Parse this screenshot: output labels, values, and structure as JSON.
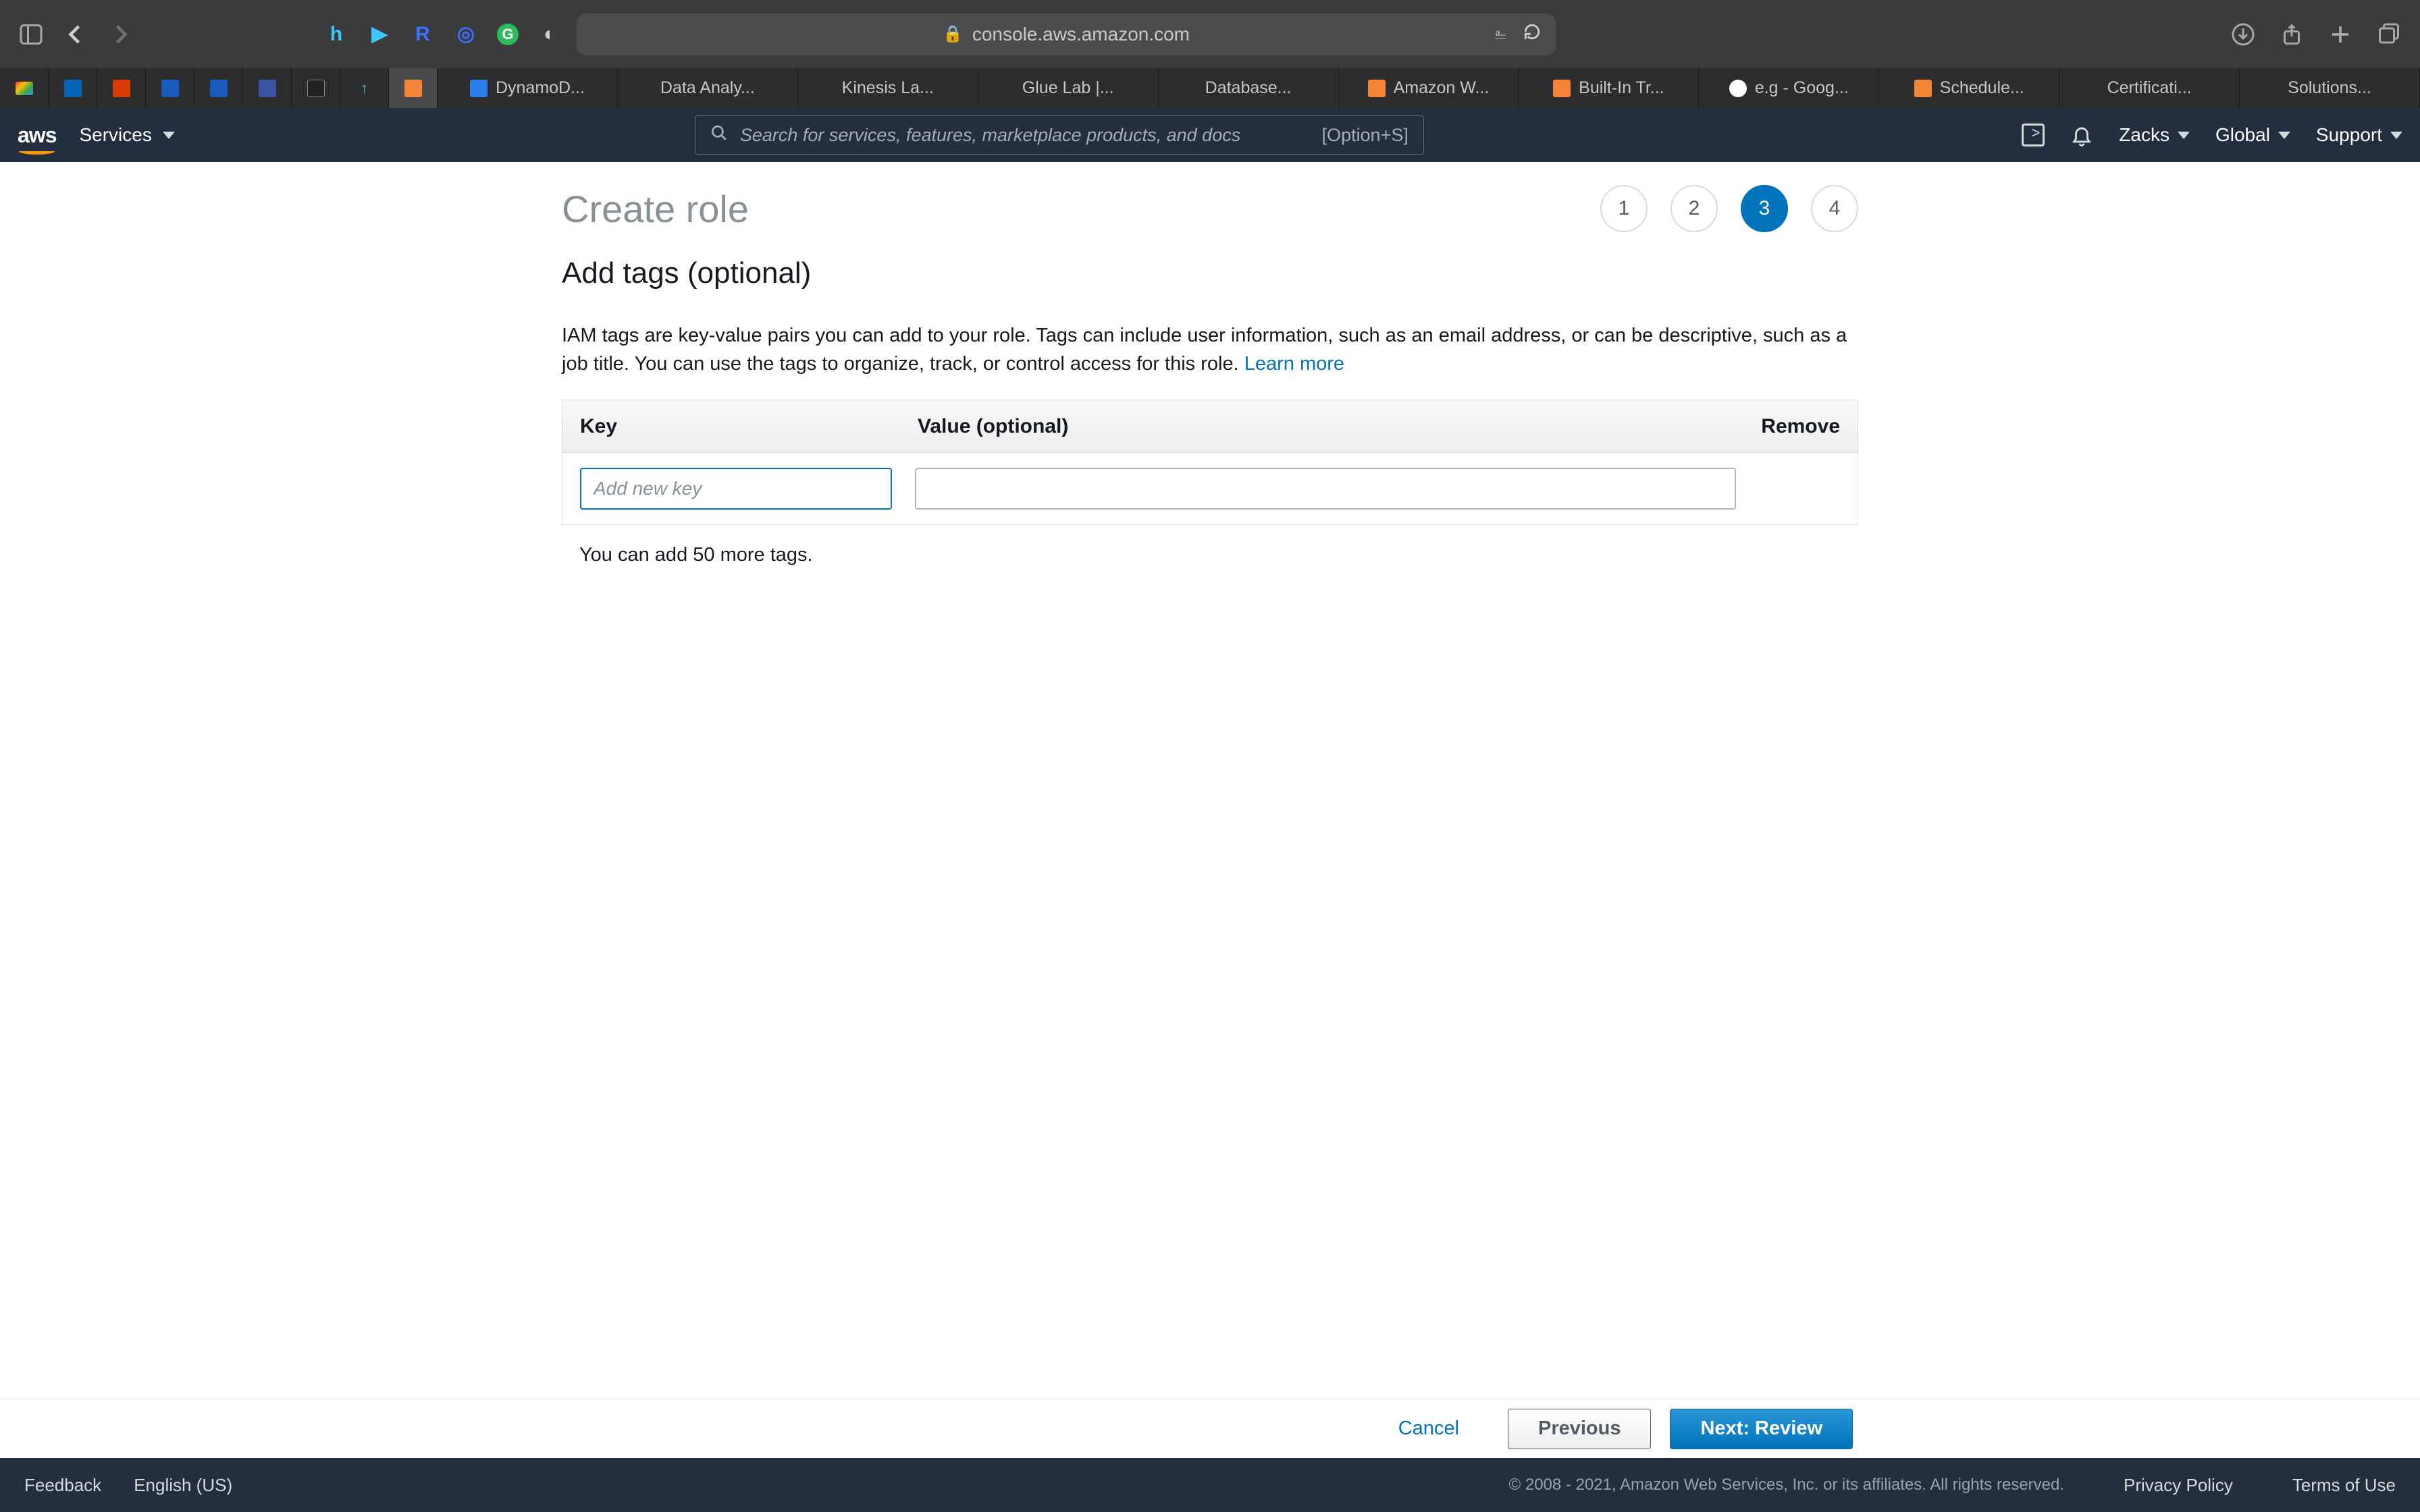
{
  "browser": {
    "url_host": "console.aws.amazon.com",
    "ext_icons": [
      "h",
      "▶",
      "R",
      "◎",
      "G",
      "◐"
    ]
  },
  "tabs": [
    {
      "icon_color": "#2b7de9",
      "label": "DynamoD..."
    },
    {
      "icon_color": "",
      "label": "Data Analy..."
    },
    {
      "icon_color": "",
      "label": "Kinesis La..."
    },
    {
      "icon_color": "",
      "label": "Glue Lab |..."
    },
    {
      "icon_color": "",
      "label": "Database..."
    },
    {
      "icon_color": "#f58536",
      "label": "Amazon W..."
    },
    {
      "icon_color": "#f58536",
      "label": "Built-In Tr..."
    },
    {
      "icon_color": "#ffffff",
      "label": "e.g - Goog..."
    },
    {
      "icon_color": "#f58536",
      "label": "Schedule..."
    },
    {
      "icon_color": "",
      "label": "Certificati..."
    },
    {
      "icon_color": "",
      "label": "Solutions..."
    }
  ],
  "aws_nav": {
    "logo": "aws",
    "services": "Services",
    "search_placeholder": "Search for services, features, marketplace products, and docs",
    "search_shortcut": "[Option+S]",
    "user": "Zacks",
    "region": "Global",
    "support": "Support"
  },
  "page": {
    "title": "Create role",
    "steps": [
      "1",
      "2",
      "3",
      "4"
    ],
    "active_step_index": 2,
    "section_title": "Add tags (optional)",
    "description_pre": "IAM tags are key-value pairs you can add to your role. Tags can include user information, such as an email address, or can be descriptive, such as a job title. You can use the tags to organize, track, or control access for this role. ",
    "learn_more": "Learn more",
    "table": {
      "col_key": "Key",
      "col_value": "Value (optional)",
      "col_remove": "Remove",
      "key_placeholder": "Add new key",
      "value_placeholder": ""
    },
    "footnote": "You can add 50 more tags."
  },
  "actions": {
    "cancel": "Cancel",
    "previous": "Previous",
    "next": "Next: Review"
  },
  "footer": {
    "feedback": "Feedback",
    "language": "English (US)",
    "copyright": "© 2008 - 2021, Amazon Web Services, Inc. or its affiliates. All rights reserved.",
    "privacy": "Privacy Policy",
    "terms": "Terms of Use"
  }
}
